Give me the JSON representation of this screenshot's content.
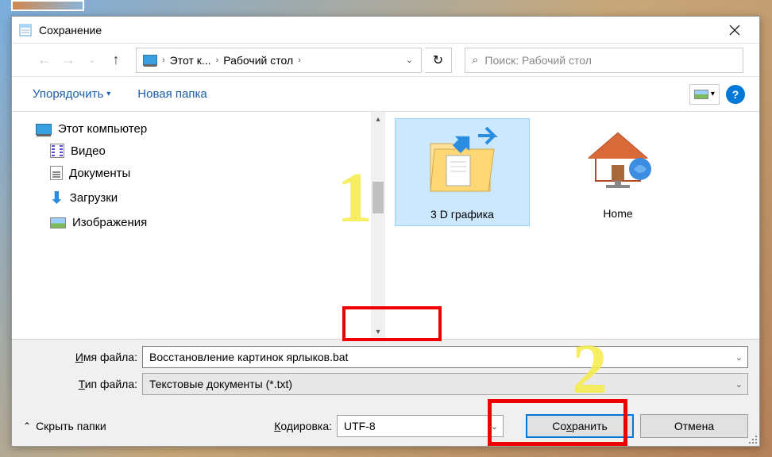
{
  "window": {
    "title": "Сохранение"
  },
  "nav": {
    "breadcrumb": {
      "item1": "Этот к...",
      "item2": "Рабочий стол"
    },
    "search_placeholder": "Поиск: Рабочий стол"
  },
  "toolbar": {
    "organize": "Упорядочить",
    "newfolder": "Новая папка"
  },
  "tree": {
    "root": "Этот компьютер",
    "items": [
      "Видео",
      "Документы",
      "Загрузки",
      "Изображения"
    ]
  },
  "files": [
    {
      "label": "3 D графика",
      "selected": true
    },
    {
      "label": "Home",
      "selected": false
    }
  ],
  "form": {
    "filename_label": "Имя файла:",
    "filename_value": "Восстановление картинок ярлыков.bat",
    "filetype_label": "Тип файла:",
    "filetype_value": "Текстовые документы (*.txt)"
  },
  "footer": {
    "hide_folders": "Скрыть папки",
    "encoding_label": "Кодировка:",
    "encoding_value": "UTF-8",
    "save": "Сохранить",
    "cancel": "Отмена"
  },
  "annotations": {
    "n1": "1",
    "n2": "2"
  }
}
